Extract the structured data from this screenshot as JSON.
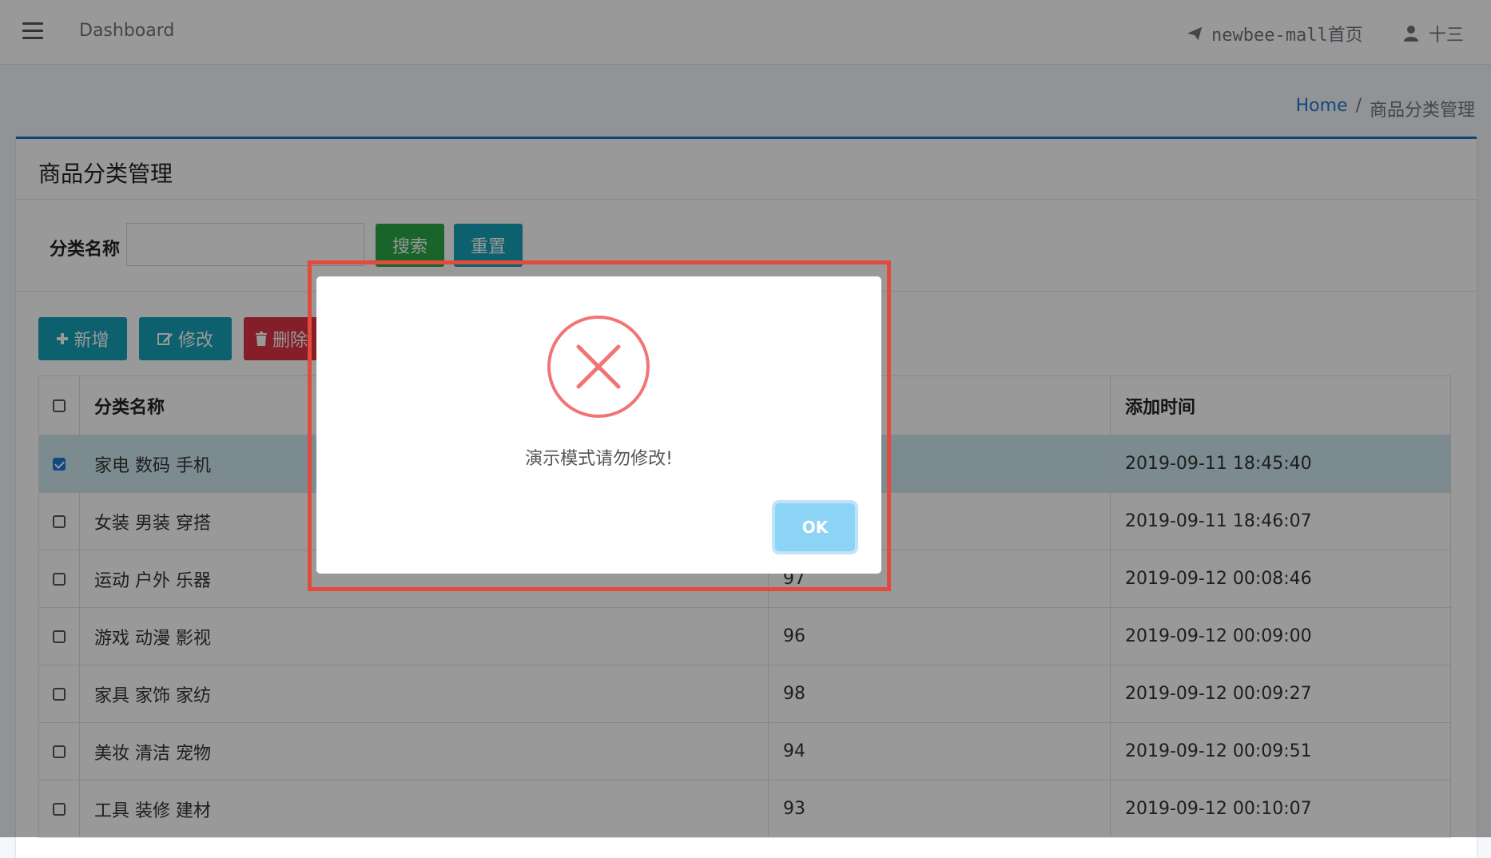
{
  "navbar": {
    "brand": "Dashboard",
    "mall_link": "newbee-mall首页",
    "user": "十三"
  },
  "breadcrumb": {
    "home": "Home",
    "separator": "/",
    "current": "商品分类管理"
  },
  "card": {
    "title": "商品分类管理"
  },
  "search": {
    "label": "分类名称",
    "value": "",
    "search_btn": "搜索",
    "reset_btn": "重置"
  },
  "toolbar": {
    "add_label": "新增",
    "edit_label": "修改",
    "delete_label": "删除"
  },
  "table": {
    "columns": [
      "分类名称",
      "",
      "添加时间"
    ],
    "rows": [
      {
        "name": "家电 数码 手机",
        "rank": "",
        "time": "2019-09-11 18:45:40",
        "checked": true
      },
      {
        "name": "女装 男装 穿搭",
        "rank": "",
        "time": "2019-09-11 18:46:07",
        "checked": false
      },
      {
        "name": "运动 户外 乐器",
        "rank": "97",
        "time": "2019-09-12 00:08:46",
        "checked": false
      },
      {
        "name": "游戏 动漫 影视",
        "rank": "96",
        "time": "2019-09-12 00:09:00",
        "checked": false
      },
      {
        "name": "家具 家饰 家纺",
        "rank": "98",
        "time": "2019-09-12 00:09:27",
        "checked": false
      },
      {
        "name": "美妆 清洁 宠物",
        "rank": "94",
        "time": "2019-09-12 00:09:51",
        "checked": false
      },
      {
        "name": "工具 装修 建材",
        "rank": "93",
        "time": "2019-09-12 00:10:07",
        "checked": false
      }
    ]
  },
  "modal": {
    "message": "演示模式请勿修改!",
    "ok_label": "OK",
    "icon": "error-x-icon"
  },
  "colors": {
    "primary": "#1e6bd6",
    "success": "#28a745",
    "info": "#17a2b8",
    "danger": "#dc3545",
    "highlight": "#e24a3c",
    "ok": "#8cd4f5"
  }
}
